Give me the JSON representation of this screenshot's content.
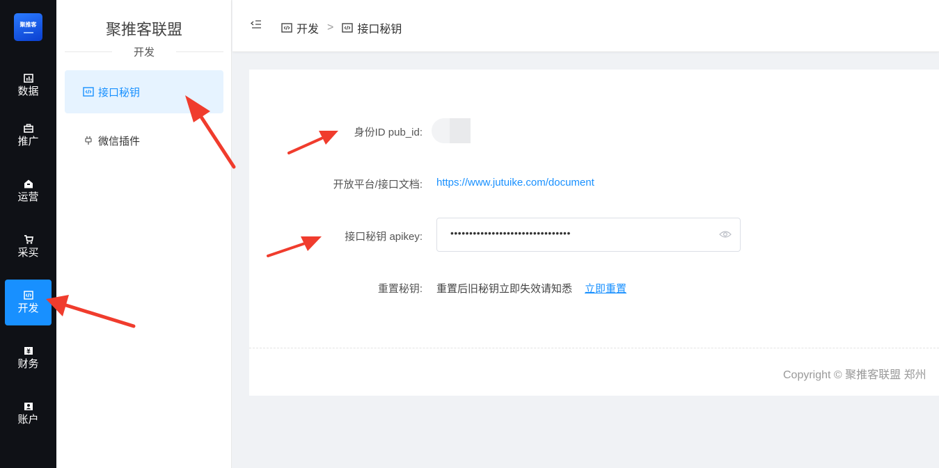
{
  "app": {
    "logo_text": "聚推客",
    "brand": "聚推客联盟",
    "section": "开发"
  },
  "rail": [
    {
      "label": "数据",
      "icon": "chart-icon"
    },
    {
      "label": "推广",
      "icon": "briefcase-icon"
    },
    {
      "label": "运营",
      "icon": "house-icon"
    },
    {
      "label": "采买",
      "icon": "cart-icon"
    },
    {
      "label": "开发",
      "icon": "code-icon",
      "active": true
    },
    {
      "label": "财务",
      "icon": "money-icon"
    },
    {
      "label": "账户",
      "icon": "user-icon"
    }
  ],
  "menu": [
    {
      "label": "接口秘钥",
      "icon": "code-icon",
      "active": true
    },
    {
      "label": "微信插件",
      "icon": "plug-icon"
    }
  ],
  "breadcrumb": {
    "collapse_icon": "menu-fold-icon",
    "first": "开发",
    "separator": ">",
    "second": "接口秘钥"
  },
  "form": {
    "pubid_label": "身份ID pub_id:",
    "doc_label": "开放平台/接口文档:",
    "doc_url": "https://www.jutuike.com/document",
    "apikey_label": "接口秘钥 apikey:",
    "apikey_value": "••••••••••••••••••••••••••••••••",
    "reset_label": "重置秘钥:",
    "reset_hint": "重置后旧秘钥立即失效请知悉",
    "reset_link": "立即重置"
  },
  "footer": {
    "copyright": "Copyright © 聚推客联盟 郑州"
  },
  "colors": {
    "accent": "#1890ff",
    "rail_bg": "#0f1116",
    "annotation": "#f03c2d"
  }
}
